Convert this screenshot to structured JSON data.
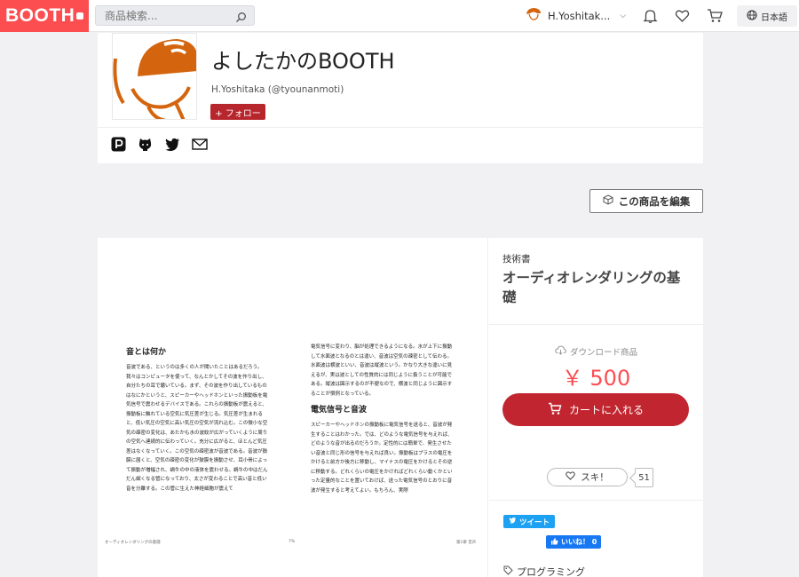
{
  "header": {
    "logo_text": "BOOTH",
    "search_placeholder": "商品検索...",
    "user_name": "H.Yoshitak...",
    "language": "日本語"
  },
  "shop": {
    "title": "よしたかのBOOTH",
    "user_line": "H.Yoshitaka (@tyounanmoti)",
    "follow_label": "+ フォロー",
    "social_icons": [
      "pixiv-icon",
      "github-icon",
      "twitter-icon",
      "mail-icon"
    ]
  },
  "edit_button": "この商品を編集",
  "preview": {
    "left_heading": "音とは何か",
    "left_paragraphs": [
      "音波である、というのは多くの人が聞いたことはあるだろう。我々はコンピュータを使って、なんとかしてその波を作り出し、自分たちの耳で聴いている。まず、その波を作り出しているものはなにかというと、スピーカーやヘッドホンといった振動板を電気信号で震わせるデバイスである。これらの振動板が震えると、振動板に触れている空気に気圧差が生じる。気圧差が生まれると、低い気圧の空気に高い気圧の空気が流れ込む。この微小な空気の疎密の変化は、あたかも水の波紋が広がっていくように周りの空気へ連続的に伝わっていく。充分に広がると、ほとんど気圧差はなくなっていく。この空気の疎密波が音波である。音波が鼓膜に届くと、空気の疎密の変化が鼓膜を振動させ、耳小骨によって振動が増幅され、蝸牛の中の液体を震わせる。蝸牛の中はだんだん細くなる管になっており、太さが変わることで高い音と低い音を分離する。この管に生えた神経細胞が震えて"
    ],
    "right_paragraphs": [
      "電気信号に変わり、脳が処理できるようになる。水が上下に振動して水面波となるのとは違い、音波は空気の疎密として伝わる。水面波は横波といい、音波は縦波という。かなり大きな違いに見えるが、実は波としての性質的には同じように扱うことが可能である。縦波は図示するのが不便なので、横波と同じように図示することが慣例となっている。"
    ],
    "right_heading": "電気信号と音波",
    "right_paragraphs_2": [
      "スピーカーやヘッドホンの振動板に電気信号を送ると、音波が発生することはわかった。では、どのような電気信号を与えれば、どのような音が出るのだろうか。定性的には簡単で、発生させたい音波と同じ形の信号を与えれば良い。振動板はプラスの電圧をかけると前方か後方に移動し、マイナスの電圧をかけるとその逆に移動する。どれくらいの電圧をかければどれくらい動くかといった定量的なことを置いておけば、送った電気信号のとおりに音波が発生すると考えてよい。もちろん、実際"
    ],
    "footer_left": "オーディオレンダリングの基礎",
    "footer_center": "7%",
    "footer_right": "第1章 音声"
  },
  "product": {
    "category": "技術書",
    "title": "オーディオレンダリングの基礎",
    "download_label": "ダウンロード商品",
    "price": "￥ 500",
    "cart_label": "カートに入れる",
    "like_label": "スキ！",
    "like_count": "51",
    "tweet_label": "ツイート",
    "fb_like_label": "いいね！ 0",
    "tag": "プログラミング"
  },
  "colors": {
    "brand": "#fc4d50",
    "cart": "#c12630",
    "follow": "#b7262d",
    "avatar_orange": "#d4650e"
  }
}
